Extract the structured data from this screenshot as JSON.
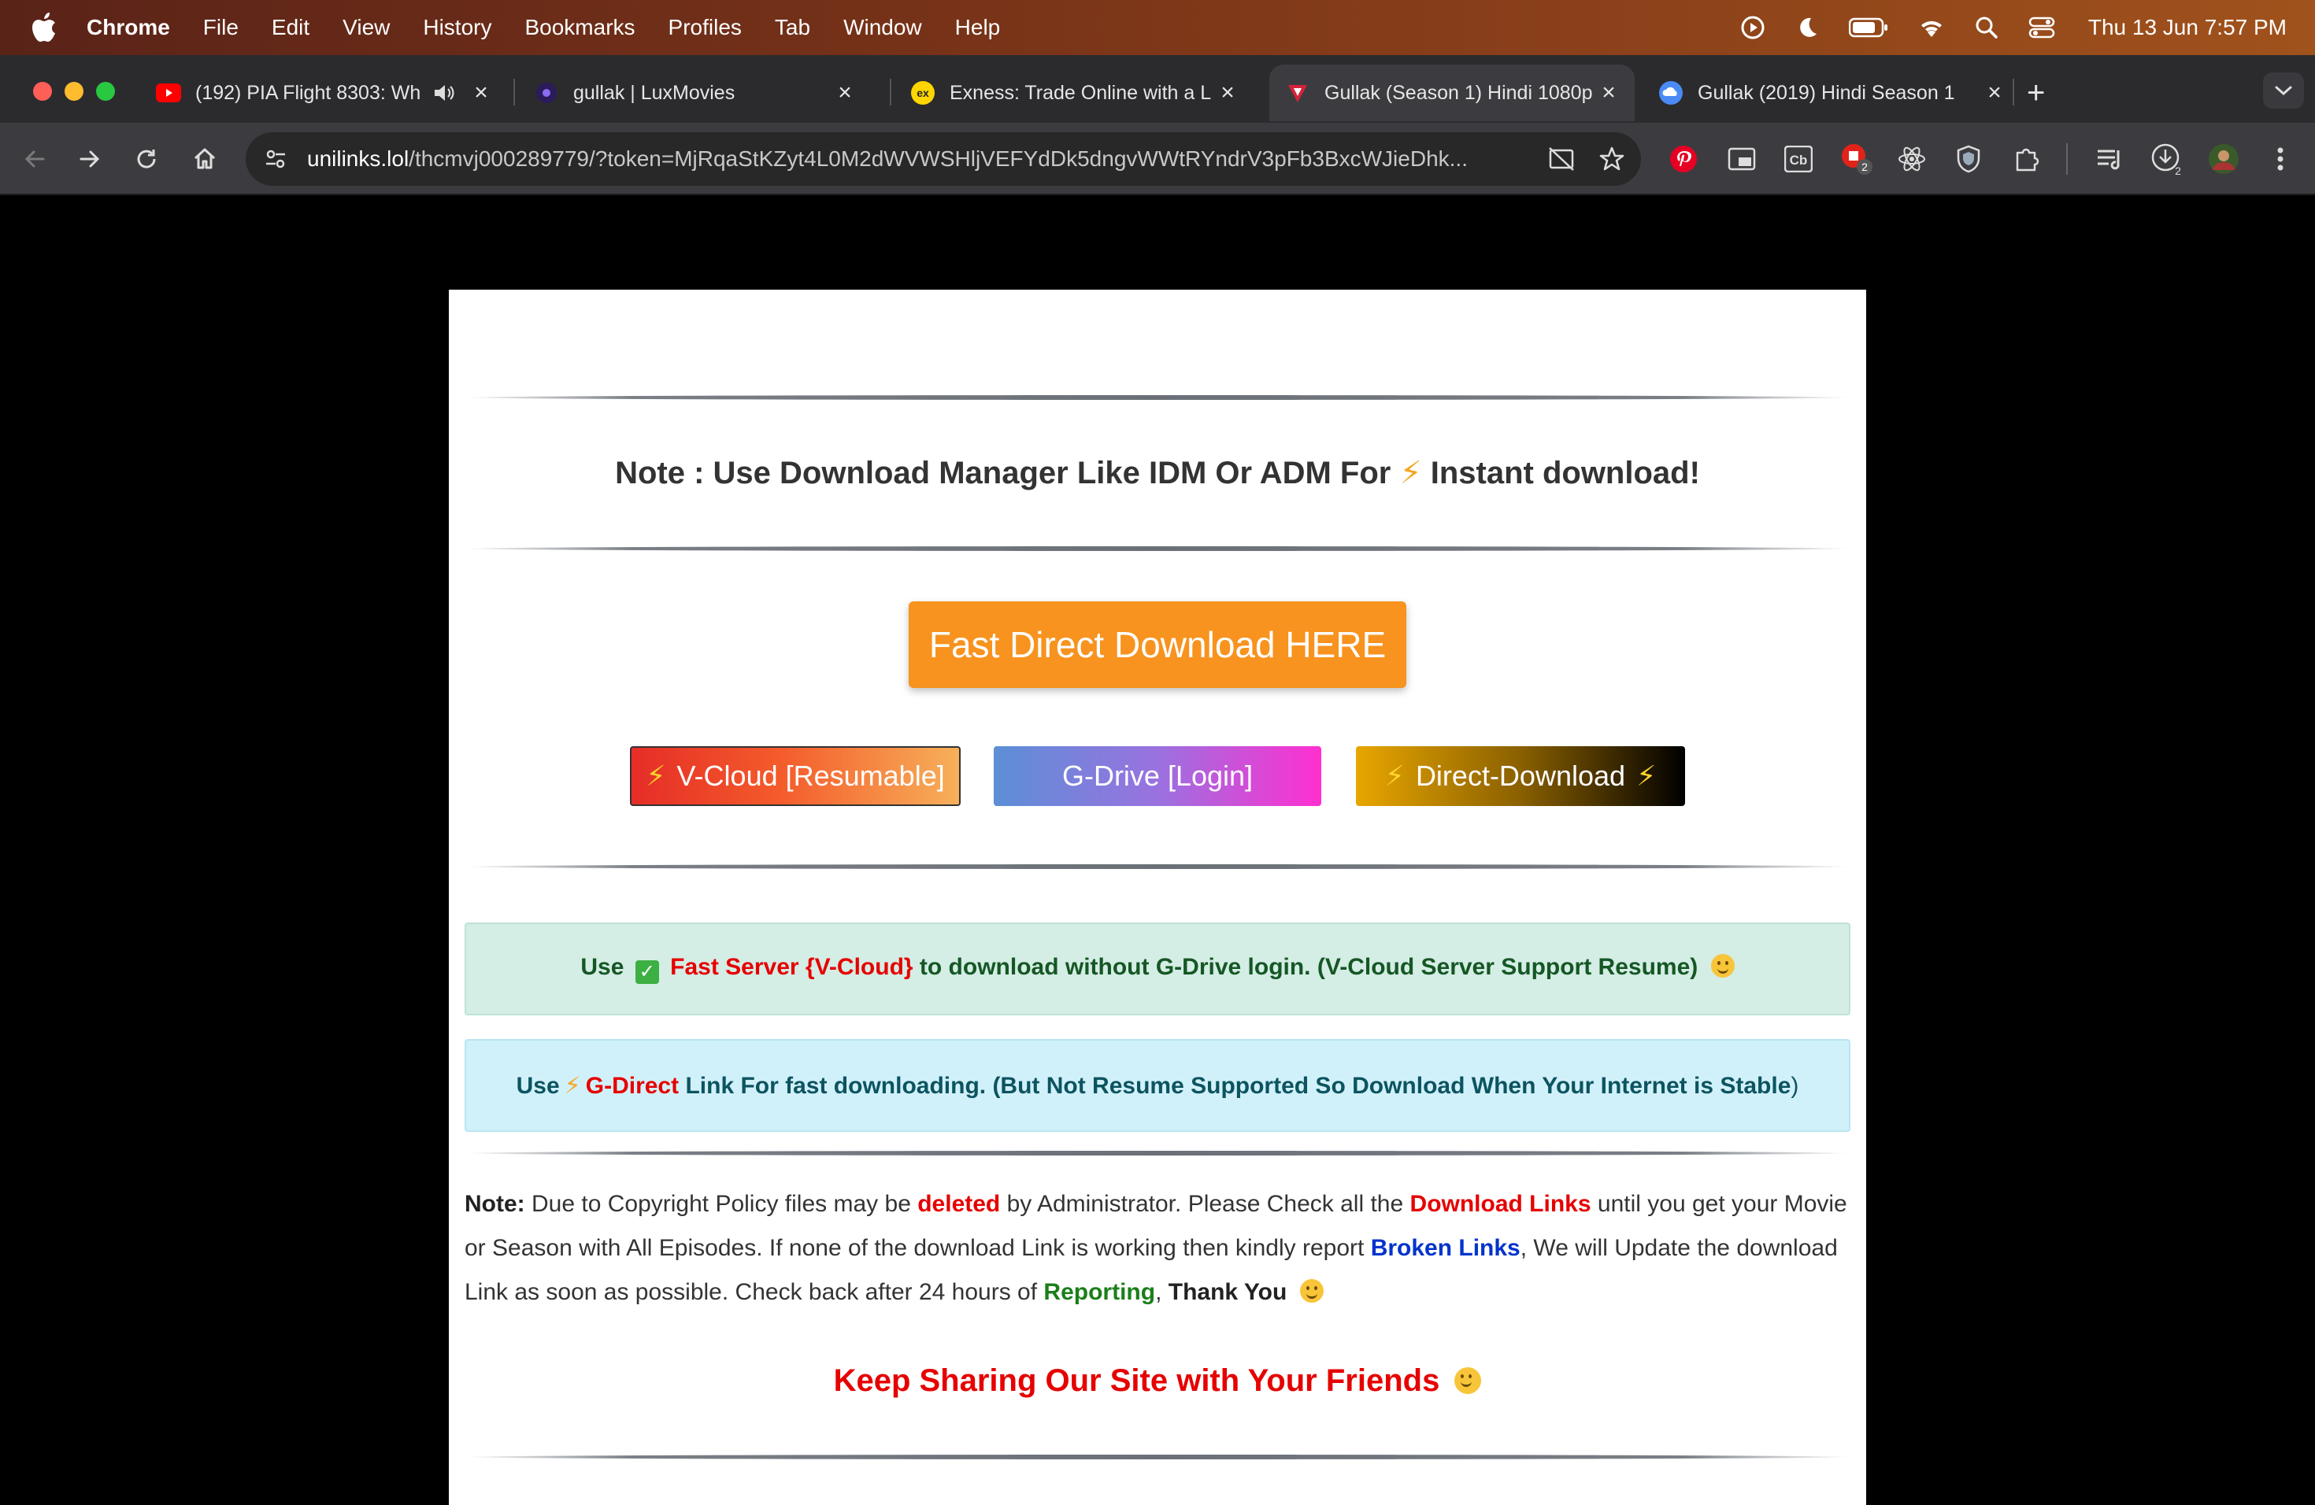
{
  "menubar": {
    "app": "Chrome",
    "items": [
      "File",
      "Edit",
      "View",
      "History",
      "Bookmarks",
      "Profiles",
      "Tab",
      "Window",
      "Help"
    ],
    "clock": "Thu 13 Jun  7:57 PM"
  },
  "tabs": [
    {
      "title": "(192) PIA Flight 8303: Wh",
      "favicon": "youtube-icon",
      "color": "#ff0000"
    },
    {
      "title": "gullak | LuxMovies",
      "favicon": "luxmovies-icon",
      "color": "#2b1b5a"
    },
    {
      "title": "Exness: Trade Online with a L",
      "favicon": "exness-icon",
      "color": "#ffd600"
    },
    {
      "title": "Gullak (Season 1) Hindi 1080p",
      "favicon": "site-icon",
      "color": "#d4233b"
    },
    {
      "title": "Gullak (2019) Hindi Season 1",
      "favicon": "cloud-icon",
      "color": "#4a8af4"
    }
  ],
  "address": {
    "domain": "unilinks.lol",
    "path": "/thcmvj000289779/?token=MjRqaStKZyt4L0M2dWVWSHljVEFYdDk5dngvWWtRYndrV3pFb3BxcWJieDhk..."
  },
  "extensions": {
    "badge1": "2",
    "badge2": "2"
  },
  "page": {
    "note_prefix": "Note : Use Download Manager Like IDM Or ADM For",
    "note_bolt": "⚡",
    "note_suffix": "Instant download!",
    "fast_button": "Fast Direct Download HERE",
    "vcloud_bolt": "⚡",
    "vcloud_label": "V-Cloud [Resumable]",
    "gdrive_label": "G-Drive [Login]",
    "direct_label": "Direct-Download",
    "direct_bolt": "⚡",
    "green_box": {
      "use": "Use",
      "check": "✓",
      "server": "Fast Server {V-Cloud}",
      "rest": "to download without G-Drive login. (V-Cloud Server Support Resume)"
    },
    "blue_box": {
      "use": "Use",
      "bolt": "⚡",
      "gdirect": "G-Direct",
      "rest": "Link For fast downloading. (But Not Resume Supported So Download When Your Internet is Stable",
      "close": ")"
    },
    "note_para": {
      "label": "Note:",
      "t1": "Due to Copyright Policy files may be",
      "deleted": "deleted",
      "t2": "by Administrator. Please Check all the",
      "download_links": "Download Links",
      "t3": "until you get your Movie or Season with All Episodes. If none of the download Link is working then kindly report",
      "broken_links": "Broken Links",
      "t4": ", We will Update the download Link as soon as possible. Check back after 24 hours of",
      "reporting": "Reporting",
      "t5": ",",
      "thank_you": "Thank You"
    },
    "keep_sharing": "Keep Sharing Our Site with Your Friends"
  }
}
